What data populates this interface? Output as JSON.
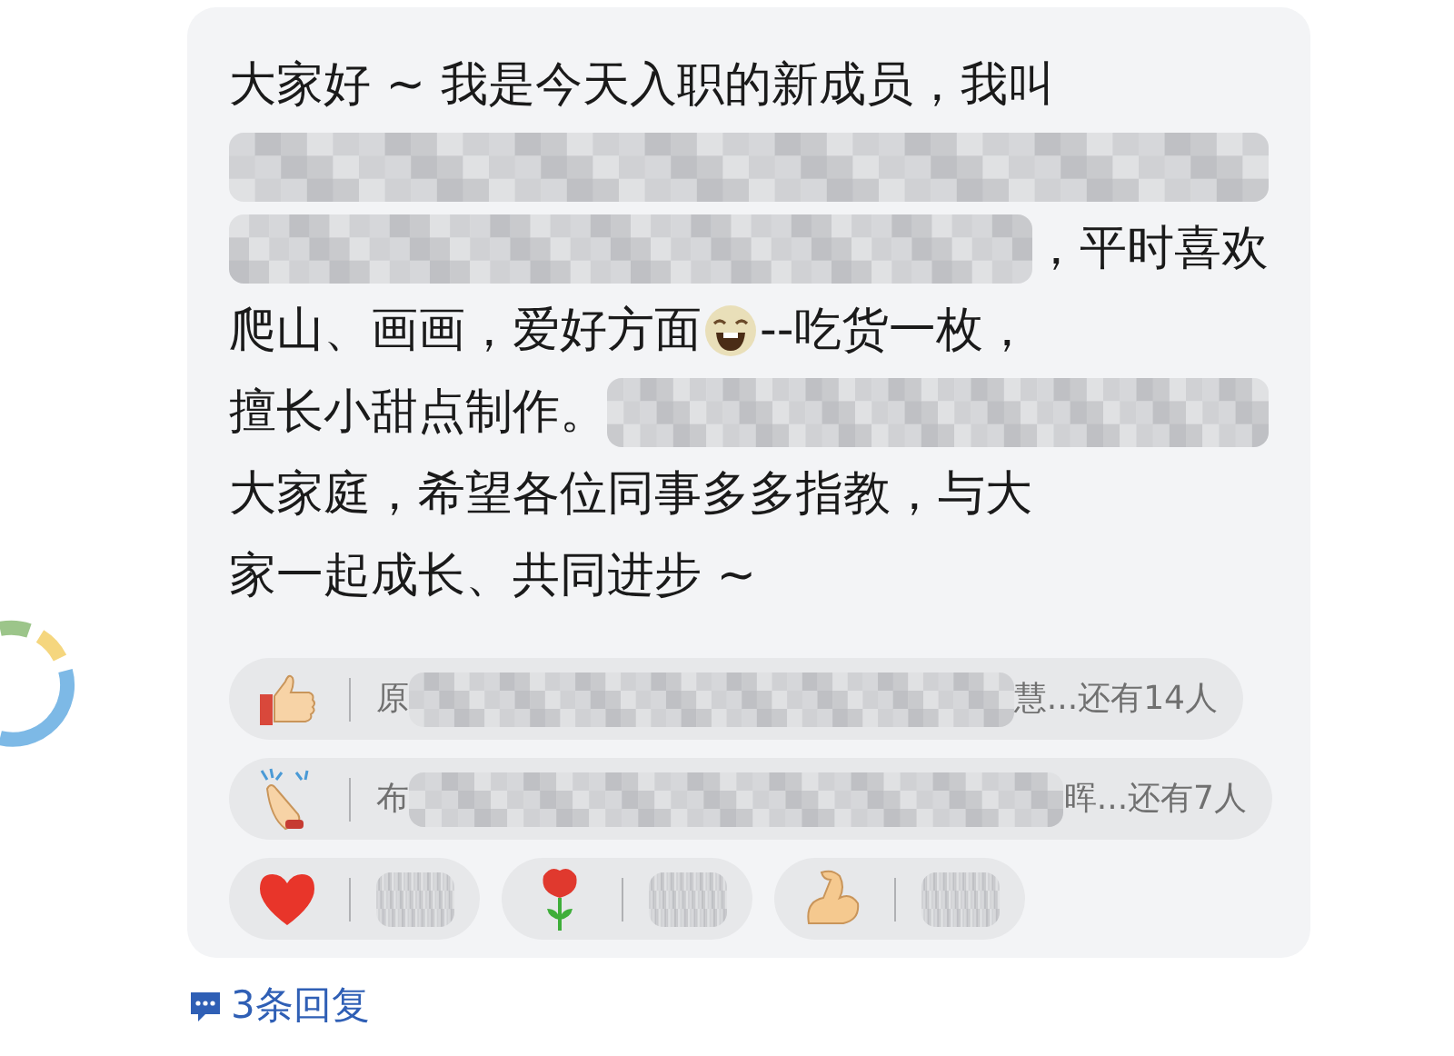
{
  "message": {
    "lines": [
      {
        "segments": [
          {
            "kind": "text",
            "text": "大家好 ~ 我是今天入职的新成员，我叫"
          }
        ]
      },
      {
        "segments": [
          {
            "kind": "redacted"
          }
        ]
      },
      {
        "segments": [
          {
            "kind": "redacted"
          },
          {
            "kind": "text",
            "text": "，平时喜欢"
          }
        ]
      },
      {
        "segments": [
          {
            "kind": "text",
            "text": "爬山、画画，爱好方面"
          },
          {
            "kind": "emoji"
          },
          {
            "kind": "text",
            "text": "--吃货一枚，"
          }
        ]
      },
      {
        "segments": [
          {
            "kind": "text",
            "text": "擅长小甜点制作。"
          },
          {
            "kind": "redacted"
          }
        ]
      },
      {
        "segments": [
          {
            "kind": "text",
            "text": "大家庭，希望各位同事多多指教，与大"
          }
        ]
      },
      {
        "segments": [
          {
            "kind": "text",
            "text": "家一起成长、共同进步 ~"
          }
        ]
      }
    ]
  },
  "reactions": [
    {
      "items": [
        {
          "kind": "thumbs_up",
          "names": [
            {
              "kind": "text",
              "text": "原"
            },
            {
              "kind": "redacted"
            },
            {
              "kind": "text",
              "text": "慧...还有14人"
            }
          ]
        }
      ]
    },
    {
      "items": [
        {
          "kind": "clap",
          "names": [
            {
              "kind": "text",
              "text": "布"
            },
            {
              "kind": "redacted"
            },
            {
              "kind": "text",
              "text": "晖...还有7人"
            }
          ]
        }
      ]
    },
    {
      "items": [
        {
          "kind": "heart",
          "names": [
            {
              "kind": "redacted"
            }
          ]
        },
        {
          "kind": "rose",
          "names": [
            {
              "kind": "redacted"
            }
          ]
        },
        {
          "kind": "muscle",
          "names": [
            {
              "kind": "redacted"
            }
          ]
        }
      ]
    }
  ],
  "replies": {
    "label": "3条回复"
  }
}
